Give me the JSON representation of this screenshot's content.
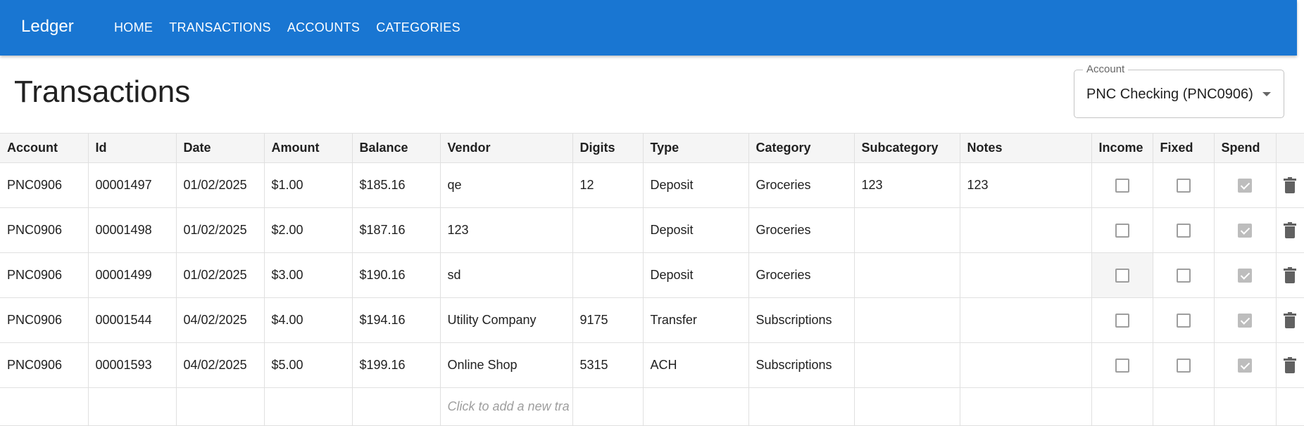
{
  "app": {
    "title": "Ledger"
  },
  "nav": [
    "HOME",
    "TRANSACTIONS",
    "ACCOUNTS",
    "CATEGORIES"
  ],
  "page": {
    "title": "Transactions"
  },
  "account_select": {
    "label": "Account",
    "value": "PNC Checking (PNC0906)"
  },
  "table": {
    "columns": [
      "Account",
      "Id",
      "Date",
      "Amount",
      "Balance",
      "Vendor",
      "Digits",
      "Type",
      "Category",
      "Subcategory",
      "Notes",
      "Income",
      "Fixed",
      "Spend"
    ],
    "rows": [
      {
        "account": "PNC0906",
        "id": "00001497",
        "date": "01/02/2025",
        "amount": "$1.00",
        "balance": "$185.16",
        "vendor": "qe",
        "digits": "12",
        "type": "Deposit",
        "category": "Groceries",
        "subcategory": "123",
        "notes": "123",
        "income": false,
        "fixed": false,
        "spend": true
      },
      {
        "account": "PNC0906",
        "id": "00001498",
        "date": "01/02/2025",
        "amount": "$2.00",
        "balance": "$187.16",
        "vendor": "123",
        "digits": "",
        "type": "Deposit",
        "category": "Groceries",
        "subcategory": "",
        "notes": "",
        "income": false,
        "fixed": false,
        "spend": true
      },
      {
        "account": "PNC0906",
        "id": "00001499",
        "date": "01/02/2025",
        "amount": "$3.00",
        "balance": "$190.16",
        "vendor": "sd",
        "digits": "",
        "type": "Deposit",
        "category": "Groceries",
        "subcategory": "",
        "notes": "",
        "income": false,
        "fixed": false,
        "spend": true
      },
      {
        "account": "PNC0906",
        "id": "00001544",
        "date": "04/02/2025",
        "amount": "$4.00",
        "balance": "$194.16",
        "vendor": "Utility Company",
        "digits": "9175",
        "type": "Transfer",
        "category": "Subscriptions",
        "subcategory": "",
        "notes": "",
        "income": false,
        "fixed": false,
        "spend": true
      },
      {
        "account": "PNC0906",
        "id": "00001593",
        "date": "04/02/2025",
        "amount": "$5.00",
        "balance": "$199.16",
        "vendor": "Online Shop",
        "digits": "5315",
        "type": "ACH",
        "category": "Subscriptions",
        "subcategory": "",
        "notes": "",
        "income": false,
        "fixed": false,
        "spend": true
      }
    ],
    "add_row_placeholder": "Click to add a new tra"
  },
  "colors": {
    "appbar": "#1976d2",
    "header_bg": "#f5f5f5",
    "border": "#e0e0e0"
  },
  "icons": {
    "delete": "trash-icon",
    "select_caret": "caret-down-icon"
  }
}
